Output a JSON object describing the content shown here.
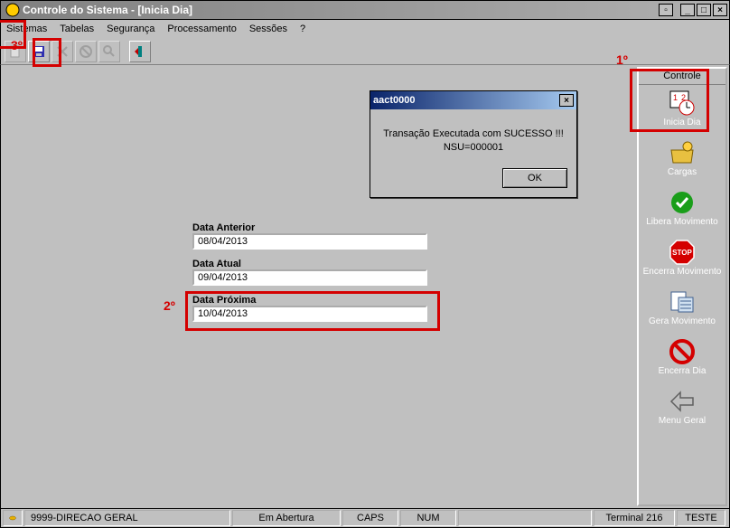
{
  "window": {
    "title": "Controle do Sistema - [Inicia Dia]"
  },
  "menu": {
    "sistemas": "Sistemas",
    "tabelas": "Tabelas",
    "seguranca": "Segurança",
    "processamento": "Processamento",
    "sessoes": "Sessões",
    "help": "?"
  },
  "side": {
    "header": "Controle",
    "items": [
      {
        "label": "Inicia Dia"
      },
      {
        "label": "Cargas"
      },
      {
        "label": "Libera Movimento"
      },
      {
        "label": "Encerra Movimento"
      },
      {
        "label": "Gera Movimento"
      },
      {
        "label": "Encerra Dia"
      },
      {
        "label": "Menu Geral"
      }
    ]
  },
  "fields": {
    "anterior_label": "Data Anterior",
    "anterior_value": "08/04/2013",
    "atual_label": "Data Atual",
    "atual_value": "09/04/2013",
    "proxima_label": "Data Próxima",
    "proxima_value": "10/04/2013"
  },
  "dialog": {
    "title": "aact0000",
    "line1": "Transação Executada com SUCESSO !!!",
    "line2": "NSU=000001",
    "ok": "OK"
  },
  "status": {
    "org": "9999-DIRECAO GERAL",
    "mode": "Em Abertura",
    "caps": "CAPS",
    "num": "NUM",
    "terminal": "Terminal 216",
    "env": "TESTE"
  },
  "annot": {
    "a1": "1º",
    "a2": "2º",
    "a3": "3º"
  }
}
